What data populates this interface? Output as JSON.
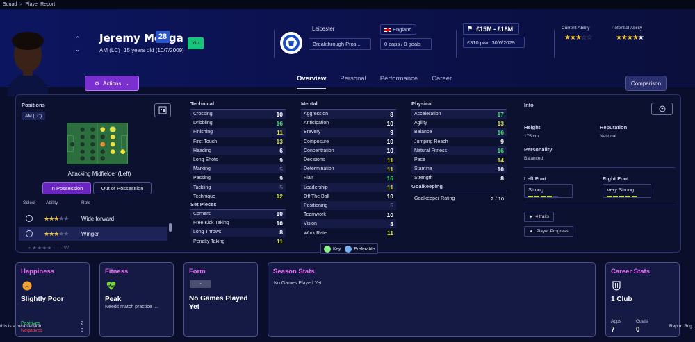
{
  "breadcrumb": {
    "root": "Squad",
    "current": "Player Report"
  },
  "player": {
    "name": "Jeremy Monga",
    "number": "28",
    "position": "AM (LC)",
    "age_dob": "15 years old (10/7/2009)",
    "badge": "Yth"
  },
  "actions_label": "Actions",
  "club": {
    "name": "Leicester",
    "contract_type": "Breakthrough Pros..."
  },
  "nation": {
    "name": "England",
    "caps": "0 caps / 0 goals"
  },
  "value": {
    "range": "£15M - £18M",
    "wage": "£310 p/w",
    "expiry": "30/6/2029"
  },
  "ability": {
    "current_label": "Current Ability",
    "current_stars": 3,
    "potential_label": "Potential Ability",
    "potential_stars": 4.5
  },
  "tabs": [
    "Overview",
    "Personal",
    "Performance",
    "Career"
  ],
  "comparison_label": "Comparison",
  "positions": {
    "title": "Positions",
    "chip": "AM (LC)",
    "role_name": "Attacking Midfielder (Left)",
    "in_possession": "In Possession",
    "out_possession": "Out of Possession",
    "headers": {
      "select": "Select",
      "ability": "Ability",
      "role": "Role"
    },
    "roles": [
      {
        "name": "Wide forward",
        "stars": 3
      },
      {
        "name": "Winger",
        "stars": 3
      }
    ]
  },
  "technical": {
    "title": "Technical",
    "rows": [
      {
        "name": "Crossing",
        "value": "10",
        "tone": "w"
      },
      {
        "name": "Dribbling",
        "value": "16",
        "tone": "g"
      },
      {
        "name": "Finishing",
        "value": "11",
        "tone": "y"
      },
      {
        "name": "First Touch",
        "value": "13",
        "tone": "y"
      },
      {
        "name": "Heading",
        "value": "6",
        "tone": "w"
      },
      {
        "name": "Long Shots",
        "value": "9",
        "tone": "w"
      },
      {
        "name": "Marking",
        "value": "5",
        "tone": "dim"
      },
      {
        "name": "Passing",
        "value": "9",
        "tone": "w"
      },
      {
        "name": "Tackling",
        "value": "5",
        "tone": "dim"
      },
      {
        "name": "Technique",
        "value": "12",
        "tone": "y"
      }
    ]
  },
  "set_pieces": {
    "title": "Set Pieces",
    "rows": [
      {
        "name": "Corners",
        "value": "10",
        "tone": "w"
      },
      {
        "name": "Free Kick Taking",
        "value": "10",
        "tone": "w"
      },
      {
        "name": "Long Throws",
        "value": "8",
        "tone": "w"
      },
      {
        "name": "Penalty Taking",
        "value": "11",
        "tone": "y"
      }
    ]
  },
  "mental": {
    "title": "Mental",
    "rows": [
      {
        "name": "Aggression",
        "value": "8",
        "tone": "w"
      },
      {
        "name": "Anticipation",
        "value": "10",
        "tone": "w"
      },
      {
        "name": "Bravery",
        "value": "9",
        "tone": "w"
      },
      {
        "name": "Composure",
        "value": "10",
        "tone": "w"
      },
      {
        "name": "Concentration",
        "value": "10",
        "tone": "w"
      },
      {
        "name": "Decisions",
        "value": "11",
        "tone": "y"
      },
      {
        "name": "Determination",
        "value": "11",
        "tone": "y"
      },
      {
        "name": "Flair",
        "value": "16",
        "tone": "g"
      },
      {
        "name": "Leadership",
        "value": "11",
        "tone": "y"
      },
      {
        "name": "Off The Ball",
        "value": "10",
        "tone": "w"
      },
      {
        "name": "Positioning",
        "value": "5",
        "tone": "dim"
      },
      {
        "name": "Teamwork",
        "value": "10",
        "tone": "w"
      },
      {
        "name": "Vision",
        "value": "8",
        "tone": "w"
      },
      {
        "name": "Work Rate",
        "value": "11",
        "tone": "y"
      }
    ]
  },
  "physical": {
    "title": "Physical",
    "rows": [
      {
        "name": "Acceleration",
        "value": "17",
        "tone": "g"
      },
      {
        "name": "Agility",
        "value": "13",
        "tone": "y"
      },
      {
        "name": "Balance",
        "value": "16",
        "tone": "g"
      },
      {
        "name": "Jumping Reach",
        "value": "9",
        "tone": "w"
      },
      {
        "name": "Natural Fitness",
        "value": "16",
        "tone": "g"
      },
      {
        "name": "Pace",
        "value": "14",
        "tone": "y"
      },
      {
        "name": "Stamina",
        "value": "10",
        "tone": "w"
      },
      {
        "name": "Strength",
        "value": "8",
        "tone": "w"
      }
    ]
  },
  "goalkeeping": {
    "title": "Goalkeeping",
    "name": "Goalkeeper Rating",
    "value": "2 / 10"
  },
  "legend": {
    "key": "Key",
    "preferable": "Preferable"
  },
  "info": {
    "title": "Info",
    "height_label": "Height",
    "height": "175 cm",
    "reputation_label": "Reputation",
    "reputation": "National",
    "personality_label": "Personality",
    "personality": "Balanced",
    "left_foot_label": "Left Foot",
    "left_foot": "Strong",
    "left_foot_level": 4,
    "right_foot_label": "Right Foot",
    "right_foot": "Very Strong",
    "right_foot_level": 5,
    "traits": "4 traits",
    "progress": "Player Progress"
  },
  "cards": {
    "happiness": {
      "title": "Happiness",
      "value": "Slightly Poor",
      "positives_label": "Positives",
      "positives": "2",
      "negatives_label": "Negatives",
      "negatives": "0"
    },
    "fitness": {
      "title": "Fitness",
      "value": "Peak",
      "note": "Needs match practice i..."
    },
    "form": {
      "title": "Form",
      "chip": "-",
      "value": "No Games Played Yet"
    },
    "season": {
      "title": "Season Stats",
      "note": "No Games Played Yet"
    },
    "career": {
      "title": "Career Stats",
      "value": "1 Club",
      "apps_label": "Apps",
      "apps": "7",
      "goals_label": "Goals",
      "goals": "0"
    }
  },
  "overlay_text": "this is a beta version",
  "report_bug": "Report Bug",
  "colors": {
    "accent_purple": "#7a2fd0",
    "card_title": "#e96cf5",
    "good": "#3ee06a",
    "ok": "#d9e22a"
  }
}
